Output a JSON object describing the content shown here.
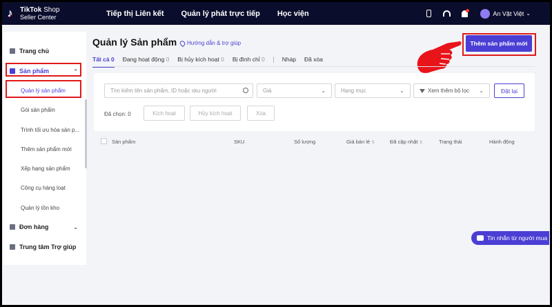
{
  "topbar": {
    "logo_line1": "TikTok",
    "logo_line1_suffix": "Shop",
    "logo_line2": "Seller Center",
    "nav": [
      "Tiếp thị Liên kết",
      "Quản lý phát trực tiếp",
      "Học viện"
    ],
    "user_name": "An Vặt Việt",
    "icons": [
      "phone-icon",
      "headset-icon",
      "bell-icon"
    ]
  },
  "sidebar": {
    "home": "Trang chủ",
    "products": "Sản phẩm",
    "sub_items": [
      "Quản lý sản phẩm",
      "Gói sản phẩm",
      "Trình tối ưu hóa sản p...",
      "Thêm sản phẩm mới",
      "Xếp hạng sản phẩm",
      "Công cụ hàng loạt",
      "Quản lý tồn kho"
    ],
    "orders": "Đơn hàng",
    "help_center": "Trung tâm Trợ giúp"
  },
  "main": {
    "title": "Quản lý Sản phẩm",
    "help_link": "Hướng dẫn & trợ giúp",
    "add_button": "Thêm sản phẩm mới",
    "tabs": [
      {
        "label": "Tất cả",
        "count": "0"
      },
      {
        "label": "Đang hoạt động",
        "count": "0"
      },
      {
        "label": "Bị hủy kích hoạt",
        "count": "0"
      },
      {
        "label": "Bị đình chỉ",
        "count": "0"
      },
      {
        "label": "Nháp",
        "count": ""
      },
      {
        "label": "Đã xóa",
        "count": ""
      }
    ],
    "filters": {
      "search_placeholder": "Tìm kiếm tên sản phẩm, ID hoặc sku người",
      "price": "Giá",
      "category": "Hạng mục",
      "more_filters": "Xem thêm bộ lọc",
      "reset": "Đặt lại"
    },
    "selected_label": "Đã chọn: 0",
    "actions": [
      "Kích hoạt",
      "Hủy kích hoạt",
      "Xóa"
    ],
    "columns": [
      "Sản phẩm",
      "SKU",
      "Số lượng",
      "Giá bán lẻ",
      "Đã cập nhật",
      "Trạng thái",
      "Hành động"
    ]
  },
  "chat_button": "Tin nhắn từ người mua",
  "colors": {
    "accent": "#4b3ed4",
    "topbar": "#0b0d2c",
    "highlight": "#e01818"
  }
}
